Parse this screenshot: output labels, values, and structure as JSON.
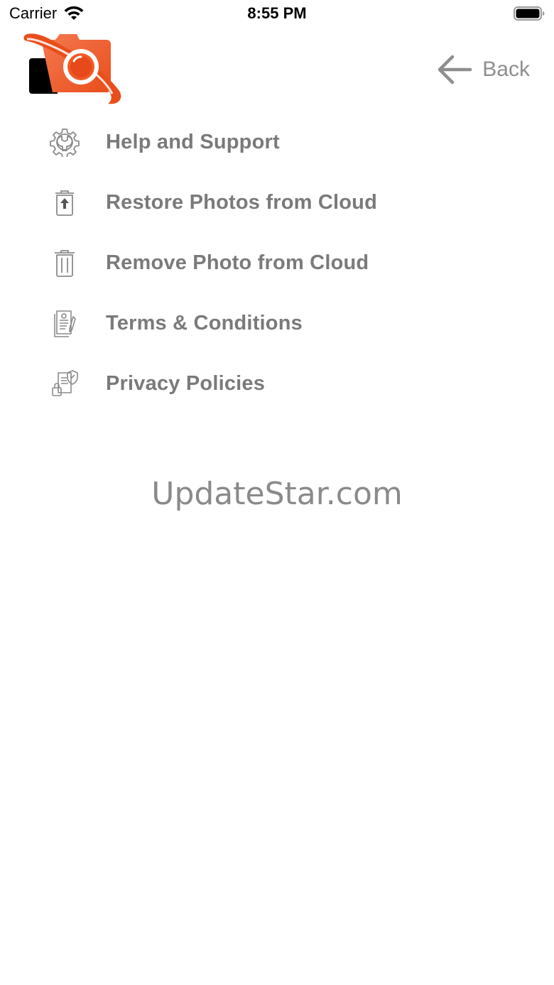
{
  "status_bar": {
    "carrier": "Carrier",
    "time": "8:55 PM"
  },
  "header": {
    "back_label": "Back"
  },
  "menu": {
    "items": [
      {
        "label": "Help and Support",
        "icon": "gear-wrench-icon"
      },
      {
        "label": "Restore Photos from Cloud",
        "icon": "trash-restore-icon"
      },
      {
        "label": "Remove Photo from Cloud",
        "icon": "trash-icon"
      },
      {
        "label": "Terms & Conditions",
        "icon": "document-pen-icon"
      },
      {
        "label": "Privacy Policies",
        "icon": "document-shield-lock-icon"
      }
    ]
  },
  "watermark": "UpdateStar.com",
  "colors": {
    "brand_orange": "#f15a24",
    "brand_dark": "#000000",
    "text_gray": "#7a7a7a",
    "icon_gray": "#8a8a8a"
  }
}
